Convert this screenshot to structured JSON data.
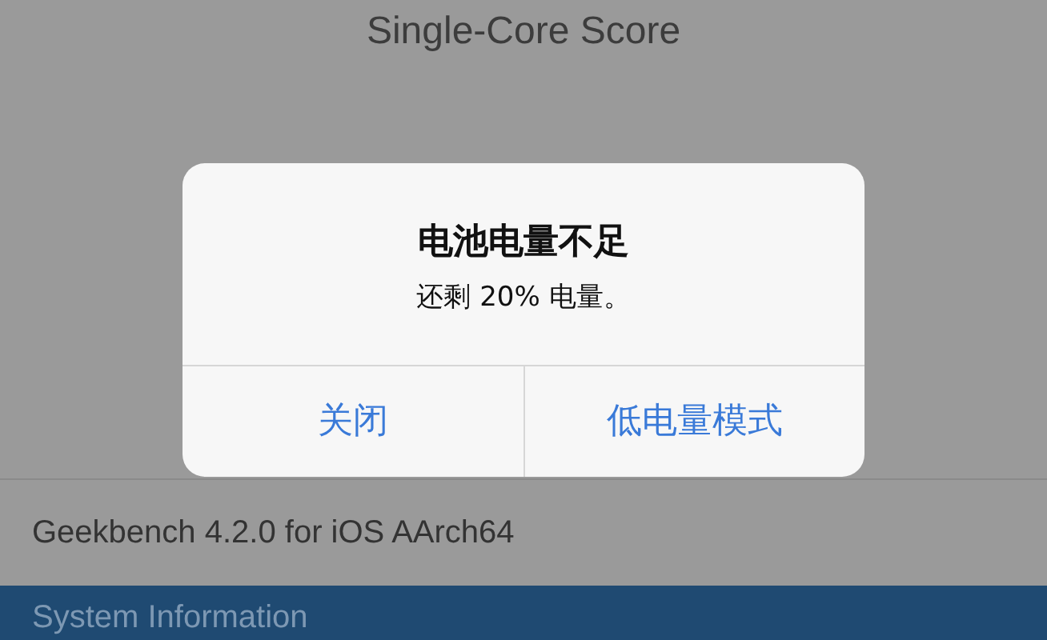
{
  "header": {
    "title": "Single-Core Score"
  },
  "rows": [
    {
      "text": "Geekbench 4.2.0 for iOS AArch64"
    }
  ],
  "section_bar": {
    "title": "System Information"
  },
  "alert": {
    "title": "电池电量不足",
    "message": "还剩 20% 电量。",
    "buttons": [
      {
        "label": "关闭"
      },
      {
        "label": "低电量模式"
      }
    ]
  }
}
